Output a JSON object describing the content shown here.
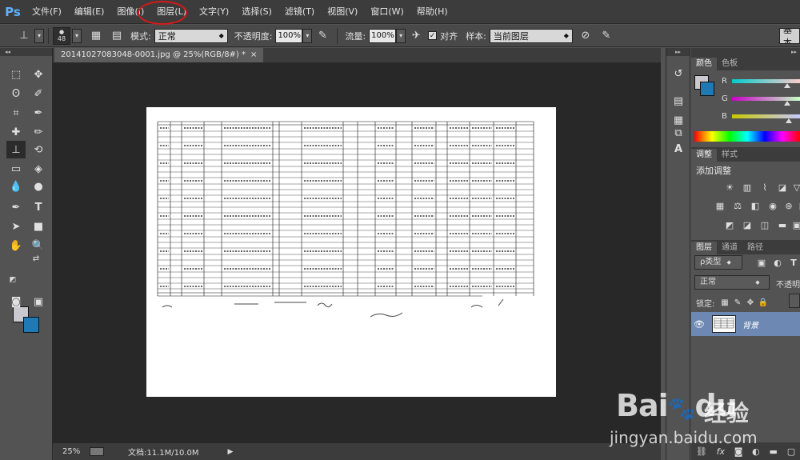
{
  "app": {
    "logo": "Ps"
  },
  "menu": [
    "文件(F)",
    "编辑(E)",
    "图像(I)",
    "图层(L)",
    "文字(Y)",
    "选择(S)",
    "滤镜(T)",
    "视图(V)",
    "窗口(W)",
    "帮助(H)"
  ],
  "options": {
    "brush_size": "48",
    "mode_label": "模式:",
    "mode_value": "正常",
    "opacity_label": "不透明度:",
    "opacity_value": "100%",
    "flow_label": "流量:",
    "flow_value": "100%",
    "aligned_label": "对齐",
    "sample_label": "样本:",
    "sample_value": "当前图层",
    "workspace_label": "基本"
  },
  "document": {
    "tab_title": "20141027083048-0001.jpg @ 25%(RGB/8#) *",
    "tab_close": "×"
  },
  "status": {
    "zoom": "25%",
    "doc_info": "文档:11.1M/10.0M"
  },
  "color_panel": {
    "tabs": [
      "颜色",
      "色板"
    ],
    "channels": [
      "R",
      "G",
      "B"
    ]
  },
  "adjust_panel": {
    "tabs": [
      "调整",
      "样式"
    ],
    "title": "添加调整"
  },
  "layers_panel": {
    "tabs": [
      "图层",
      "通道",
      "路径"
    ],
    "filter_label": "ρ类型",
    "blend_mode": "正常",
    "opacity_label": "不透明",
    "lock_label": "锁定:",
    "layer_name": "背景"
  },
  "watermark": {
    "brand": "Bai",
    "brand2": "du",
    "cn": "经验",
    "url": "jingyan.baidu.com"
  },
  "colors": {
    "foreground": "#c9c9cf",
    "background": "#1f79b5",
    "highlight": "#d81818"
  }
}
